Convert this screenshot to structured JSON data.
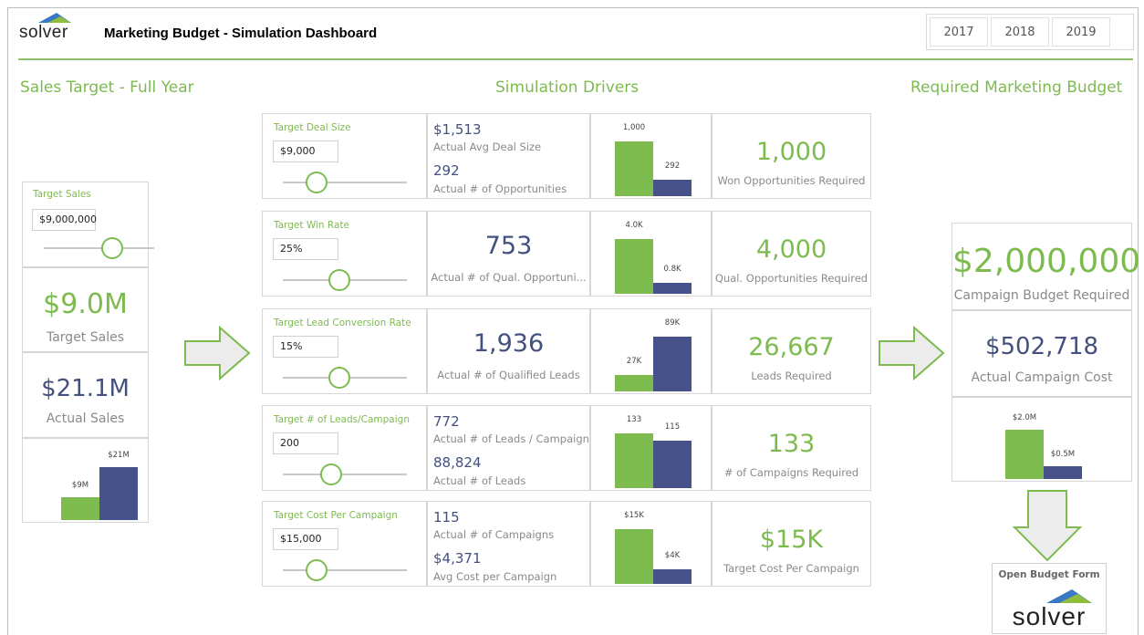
{
  "header": {
    "logo_text": "solver",
    "title": "Marketing Budget - Simulation Dashboard",
    "years": [
      "2017",
      "2018",
      "2019"
    ]
  },
  "sections": {
    "left": "Sales Target - Full Year",
    "middle": "Simulation Drivers",
    "right": "Required Marketing Budget"
  },
  "colors": {
    "accent_green": "#7dbb4f",
    "navy": "#47528a"
  },
  "left_panel": {
    "slider_label": "Target Sales",
    "slider_value": "$9,000,000",
    "target_value": "$9.0M",
    "target_caption": "Target Sales",
    "actual_value": "$21.1M",
    "actual_caption": "Actual Sales",
    "chart": {
      "target_label": "$9M",
      "actual_label": "$21M",
      "target": 9,
      "actual": 21
    }
  },
  "drivers": [
    {
      "slider_label": "Target Deal Size",
      "slider_value": "$9,000",
      "slider_pos": 0.3,
      "mid_type": "two",
      "m1_value": "$1,513",
      "m1_caption": "Actual Avg Deal Size",
      "m2_value": "292",
      "m2_caption": "Actual # of Opportunities",
      "chart": {
        "g_label": "1,000",
        "n_label": "292",
        "g": 1000,
        "n": 292
      },
      "result_value": "1,000",
      "result_caption": "Won Opportunities Required"
    },
    {
      "slider_label": "Target Win Rate",
      "slider_value": "25%",
      "slider_pos": 0.5,
      "mid_type": "one",
      "m1_value": "753",
      "m1_caption": "Actual # of Qual. Opportuni...",
      "chart": {
        "g_label": "4.0K",
        "n_label": "0.8K",
        "g": 4000,
        "n": 800
      },
      "result_value": "4,000",
      "result_caption": "Qual. Opportunities Required"
    },
    {
      "slider_label": "Target Lead Conversion Rate",
      "slider_value": "15%",
      "slider_pos": 0.5,
      "mid_type": "one",
      "m1_value": "1,936",
      "m1_caption": "Actual # of Qualified Leads",
      "chart": {
        "g_label": "27K",
        "n_label": "89K",
        "g": 27000,
        "n": 89000
      },
      "result_value": "26,667",
      "result_caption": "Leads Required"
    },
    {
      "slider_label": "Target # of Leads/Campaign",
      "slider_value": "200",
      "slider_pos": 0.43,
      "mid_type": "two",
      "m1_value": "772",
      "m1_caption": "Actual # of Leads / Campaign",
      "m2_value": "88,824",
      "m2_caption": "Actual # of Leads",
      "chart": {
        "g_label": "133",
        "n_label": "115",
        "g": 133,
        "n": 115
      },
      "result_value": "133",
      "result_caption": "# of Campaigns Required"
    },
    {
      "slider_label": "Target Cost Per Campaign",
      "slider_value": "$15,000",
      "slider_pos": 0.3,
      "mid_type": "two",
      "m1_value": "115",
      "m1_caption": "Actual # of Campaigns",
      "m2_value": "$4,371",
      "m2_caption": "Avg Cost per Campaign",
      "chart": {
        "g_label": "$15K",
        "n_label": "$4K",
        "g": 15,
        "n": 4
      },
      "result_value": "$15K",
      "result_caption": "Target Cost Per Campaign"
    }
  ],
  "right_panel": {
    "budget_value": "$2,000,000",
    "budget_caption": "Campaign Budget Required",
    "actual_value": "$502,718",
    "actual_caption": "Actual Campaign Cost",
    "chart": {
      "g_label": "$2.0M",
      "n_label": "$0.5M",
      "g": 2.0,
      "n": 0.5
    }
  },
  "open_budget": {
    "label": "Open Budget Form",
    "logo_text": "solver"
  }
}
